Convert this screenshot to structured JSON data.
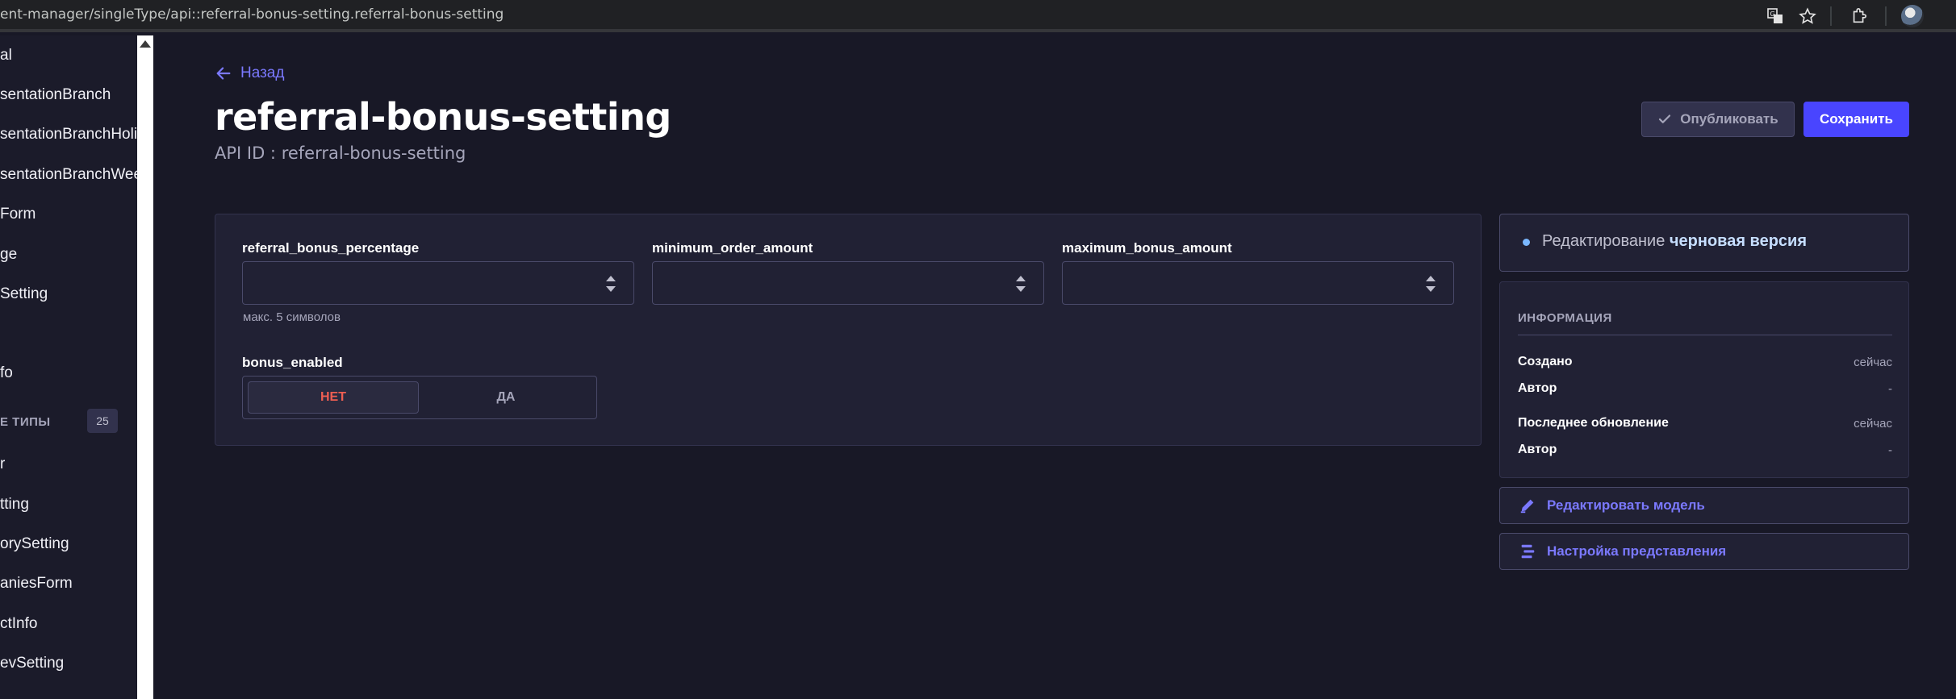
{
  "browser": {
    "url": "ent-manager/singleType/api::referral-bonus-setting.referral-bonus-setting",
    "icons": [
      "translate-icon",
      "star-icon",
      "extensions-icon",
      "avatar"
    ]
  },
  "sidebar": {
    "items_top": [
      "al",
      "sentationBranch",
      "sentationBranchHoli",
      "sentationBranchWee",
      "Form",
      "ge",
      "Setting",
      "fo"
    ],
    "section_label": "Е ТИПЫ",
    "section_count": "25",
    "items_bottom": [
      "r",
      "tting",
      "orySetting",
      "aniesForm",
      "ctInfo",
      "evSetting"
    ]
  },
  "header": {
    "back_label": "Назад",
    "title": "referral-bonus-setting",
    "api_id": "API ID : referral-bonus-setting",
    "publish_label": "Опубликовать",
    "save_label": "Сохранить"
  },
  "form": {
    "fields": [
      {
        "label": "referral_bonus_percentage",
        "value": "",
        "hint": "макс. 5 символов"
      },
      {
        "label": "minimum_order_amount",
        "value": ""
      },
      {
        "label": "maximum_bonus_amount",
        "value": ""
      }
    ],
    "bonus_enabled": {
      "label": "bonus_enabled",
      "no_label": "НЕТ",
      "yes_label": "ДА",
      "selected": "НЕТ"
    }
  },
  "status": {
    "prefix": "Редактирование",
    "version": "черновая версия"
  },
  "info": {
    "heading": "ИНФОРМАЦИЯ",
    "created_label": "Создано",
    "created_value": "сейчас",
    "author_label": "Автор",
    "author_value": "-",
    "updated_label": "Последнее обновление",
    "updated_value": "сейчас",
    "author2_label": "Автор",
    "author2_value": "-"
  },
  "actions": {
    "edit_model": "Редактировать модель",
    "configure_view": "Настройка представления"
  },
  "colors": {
    "background": "#181826",
    "panel": "#212134",
    "primary": "#4945ff",
    "link": "#7b79ff",
    "danger": "#ee5e52"
  }
}
